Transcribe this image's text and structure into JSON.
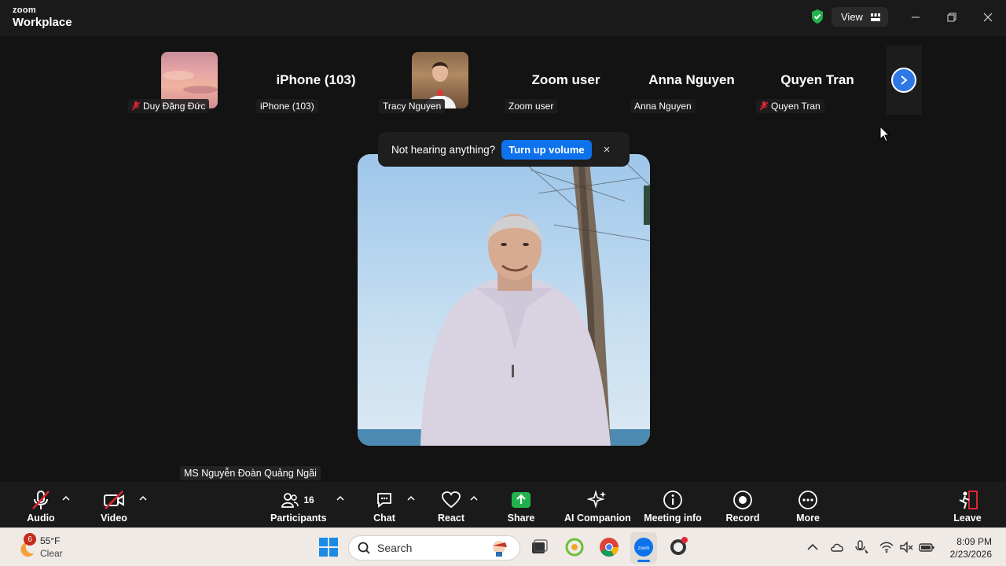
{
  "window": {
    "brand_line1": "zoom",
    "brand_line2": "Workplace",
    "view_label": "View"
  },
  "filmstrip": {
    "participants": [
      {
        "label": "Duy Đặng Đức",
        "muted": true,
        "type": "photo-sunset"
      },
      {
        "label": "iPhone (103)",
        "display_name": "iPhone (103)",
        "muted": false,
        "type": "name"
      },
      {
        "label": "Tracy Nguyen",
        "muted": false,
        "type": "photo-person"
      },
      {
        "label": "Zoom user",
        "display_name": "Zoom user",
        "muted": false,
        "type": "name"
      },
      {
        "label": "Anna Nguyen",
        "display_name": "Anna Nguyen",
        "muted": false,
        "type": "name"
      },
      {
        "label": "Quyen Tran",
        "display_name": "Quyen Tran",
        "muted": true,
        "type": "name"
      }
    ]
  },
  "notification": {
    "message": "Not hearing anything?",
    "action": "Turn up volume",
    "close": "×"
  },
  "main": {
    "speaker_label": "MS Nguyễn Đoàn Quảng Ngãi"
  },
  "toolbar": {
    "audio": "Audio",
    "video": "Video",
    "participants": "Participants",
    "participants_count": "16",
    "chat": "Chat",
    "react": "React",
    "share": "Share",
    "ai_companion": "AI Companion",
    "meeting_info": "Meeting info",
    "record": "Record",
    "more": "More",
    "leave": "Leave"
  },
  "taskbar": {
    "weather_badge": "6",
    "temperature": "55°F",
    "condition": "Clear",
    "search_placeholder": "Search",
    "time": "8:09 PM",
    "date": "2/23/2026"
  },
  "colors": {
    "accent_blue": "#0e72ed",
    "share_green": "#22b14c",
    "muted_red": "#e0262f",
    "leave_red": "#e0262f"
  }
}
